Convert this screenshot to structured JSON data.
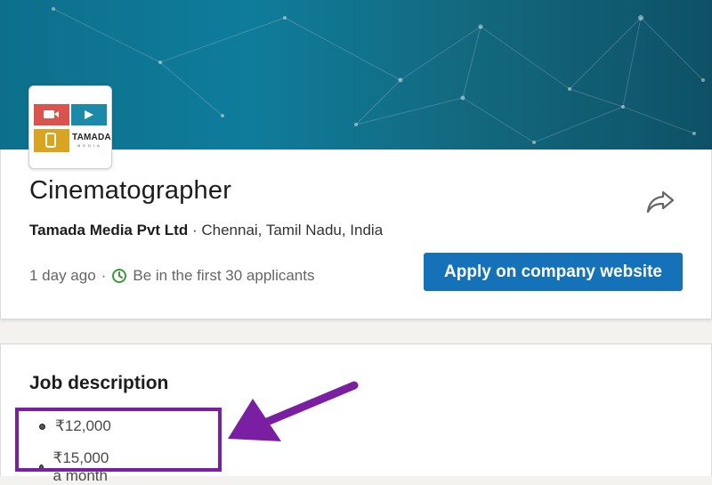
{
  "job": {
    "title": "Cinematographer",
    "company": "Tamada Media Pvt Ltd",
    "separator": "·",
    "location": "Chennai, Tamil Nadu, India",
    "posted": "1 day ago",
    "applicants": "Be in the first 30 applicants",
    "apply_label": "Apply on company website"
  },
  "logo": {
    "text": "TAMADA",
    "subtext": "MEDIA"
  },
  "description": {
    "heading": "Job description",
    "salaries": [
      "₹12,000",
      "₹15,000 a month"
    ]
  },
  "colors": {
    "apply_button": "#1572b9",
    "highlight": "#7a1fa2",
    "clock": "#3a9a3a"
  },
  "icons": {
    "share": "share-arrow-icon",
    "clock": "clock-icon"
  }
}
